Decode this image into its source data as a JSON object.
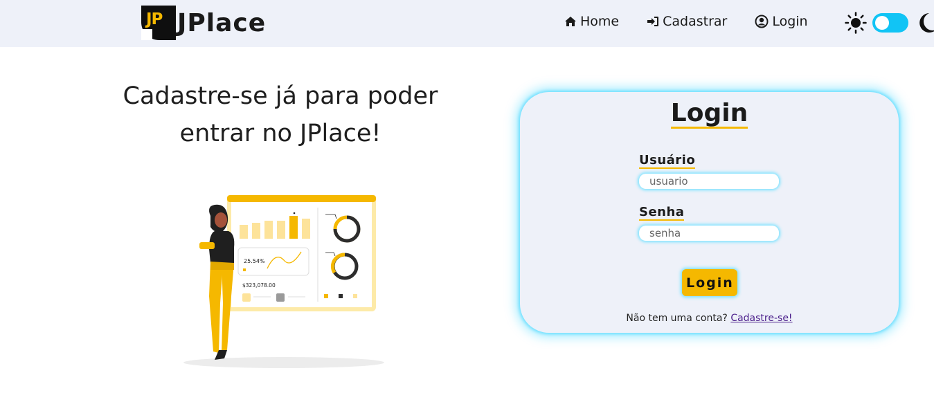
{
  "brand": {
    "logo_mark": "JP",
    "name": "JPlace",
    "accent": "#f5b800"
  },
  "nav": {
    "items": [
      {
        "label": "Home",
        "icon": "home-icon"
      },
      {
        "label": "Cadastrar",
        "icon": "sign-in-icon"
      },
      {
        "label": "Login",
        "icon": "user-circle-icon"
      }
    ],
    "theme_toggle": {
      "light_icon": "sun-icon",
      "dark_icon": "moon-icon",
      "state": "light",
      "color": "#11c4f5"
    }
  },
  "hero": {
    "title_line1": "Cadastre-se já para poder",
    "title_line2": "entrar no JPlace!",
    "illustration": {
      "percent_label": "25.54%",
      "amount_label": "$323,078.00"
    }
  },
  "login_card": {
    "title": "Login",
    "username": {
      "label": "Usuário",
      "placeholder": "usuario",
      "value": ""
    },
    "password": {
      "label": "Senha",
      "placeholder": "senha",
      "value": ""
    },
    "submit_label": "Login",
    "signup_prompt": "Não tem uma conta?",
    "signup_link": "Cadastre-se!"
  }
}
